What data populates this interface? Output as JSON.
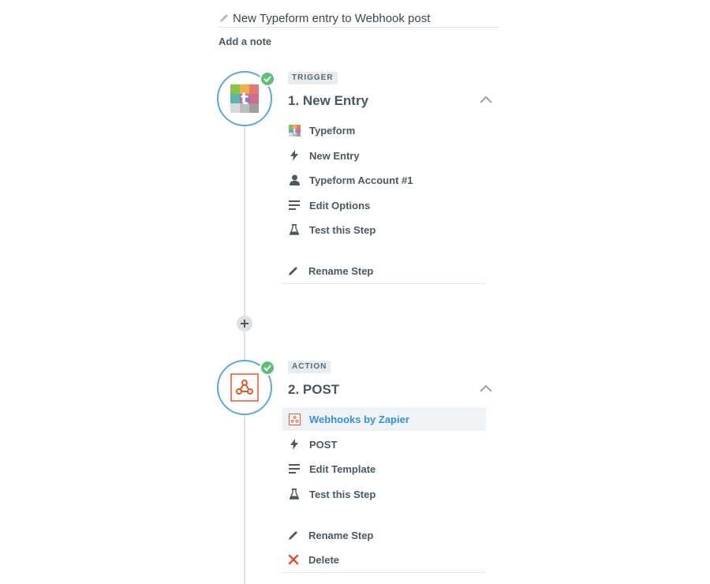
{
  "zap": {
    "title": "New Typeform entry to Webhook post",
    "add_note_label": "Add a note"
  },
  "steps": [
    {
      "tag": "TRIGGER",
      "title": "1. New Entry",
      "app_icon": "typeform-icon",
      "items": [
        {
          "label": "Typeform",
          "icon": "typeform-icon"
        },
        {
          "label": "New Entry",
          "icon": "bolt-icon"
        },
        {
          "label": "Typeform Account #1",
          "icon": "user-icon"
        },
        {
          "label": "Edit Options",
          "icon": "list-icon"
        },
        {
          "label": "Test this Step",
          "icon": "flask-icon"
        }
      ],
      "rename_label": "Rename Step"
    },
    {
      "tag": "ACTION",
      "title": "2. POST",
      "app_icon": "webhook-icon",
      "items": [
        {
          "label": "Webhooks by Zapier",
          "icon": "webhook-icon",
          "selected": true
        },
        {
          "label": "POST",
          "icon": "bolt-icon"
        },
        {
          "label": "Edit Template",
          "icon": "list-icon"
        },
        {
          "label": "Test this Step",
          "icon": "flask-icon"
        }
      ],
      "rename_label": "Rename Step",
      "delete_label": "Delete"
    }
  ],
  "colors": {
    "step_ring": "#5aa6e6",
    "success": "#5ec07a",
    "selected_text": "#3b8fdb",
    "webhook": "#e2582c",
    "delete": "#e0522f"
  }
}
